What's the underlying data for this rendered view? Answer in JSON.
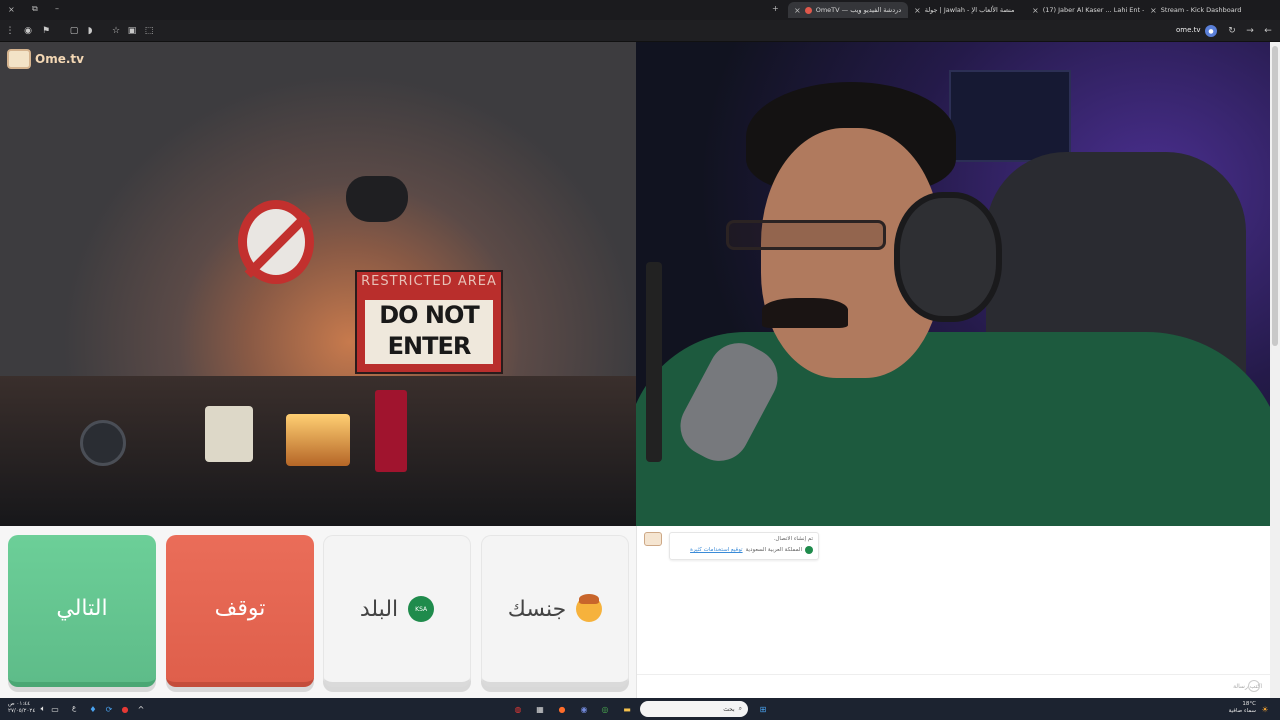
{
  "browser": {
    "tabs": [
      {
        "title": "OmeTV — دردشة الفيديو ويب",
        "active": true,
        "color": "#e0584b"
      },
      {
        "title": "جولة | Jawlah - منصة الألعاب الإ",
        "active": false,
        "color": "#8a8a8a"
      },
      {
        "title": "(17) Jaber Al Kaser ... Lahi Ent -",
        "active": false,
        "color": "#e53935"
      },
      {
        "title": "Stream - Kick Dashboard",
        "active": false,
        "color": "#53fc18"
      }
    ],
    "new_tab": "+",
    "url": "ome.tv",
    "close_glyph": "×",
    "back_glyph": "←",
    "forward_glyph": "→",
    "reload_glyph": "↻",
    "menu_glyph": "⋮",
    "star_glyph": "☆"
  },
  "app": {
    "logo_text": "Ome.tv"
  },
  "left_cam": {
    "sign_top": "RESTRICTED AREA",
    "sign_line1": "DO NOT",
    "sign_line2": "ENTER"
  },
  "controls": {
    "next_label": "التالي",
    "stop_label": "توقف",
    "country_label": "البلد",
    "country_flag_text": "KSA",
    "gender_label": "جنسك"
  },
  "chat": {
    "system_line1": "تم إنشاء الاتصال.",
    "country_name": "المملكة العربية السعودية",
    "report_link": "توقيع استخدامات كثيرة",
    "input_placeholder": "اكتب رسالة"
  },
  "taskbar": {
    "search_placeholder": "بحث",
    "weather": "18°C",
    "weather_desc": "سماء صافية",
    "time": "٠١:٤٤ ص",
    "date": "٢٧/٠٥/٢٠٢٤",
    "lang": "ع"
  }
}
